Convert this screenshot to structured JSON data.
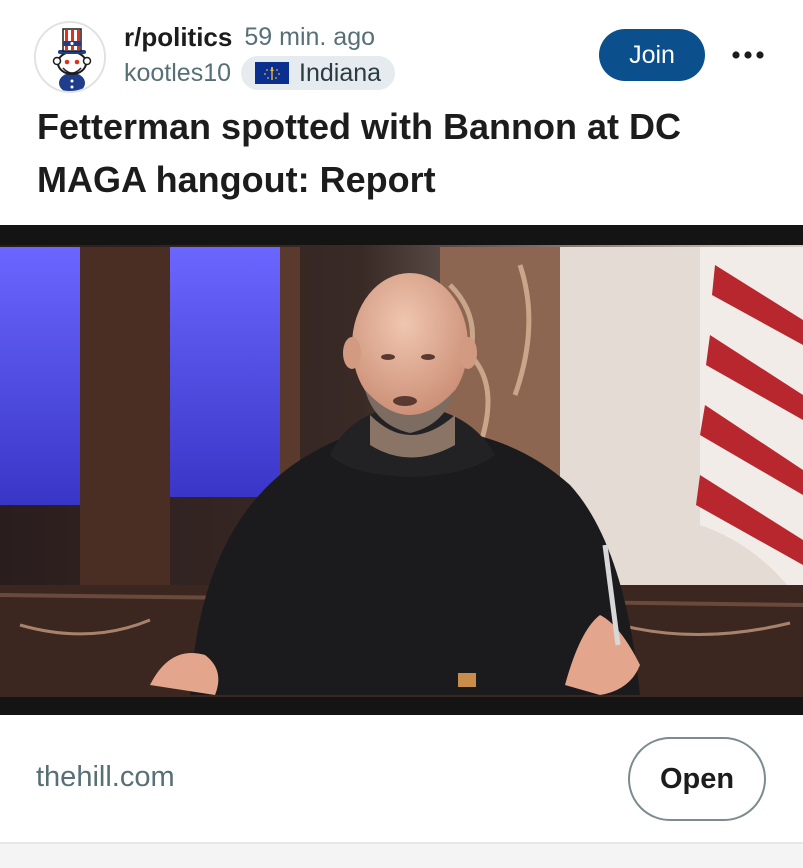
{
  "post": {
    "subreddit": "r/politics",
    "time_ago": "59 min. ago",
    "username": "kootles10",
    "flair": {
      "text": "Indiana",
      "icon": "indiana-flag-icon"
    },
    "join_label": "Join",
    "more_icon": "more-options-icon",
    "title": "Fetterman spotted with Bannon at DC MAGA hangout: Report"
  },
  "link": {
    "domain": "thehill.com",
    "open_label": "Open"
  },
  "colors": {
    "join_button": "#0b4f8c",
    "meta_text": "#576f76",
    "flair_bg": "#e5ebee"
  }
}
